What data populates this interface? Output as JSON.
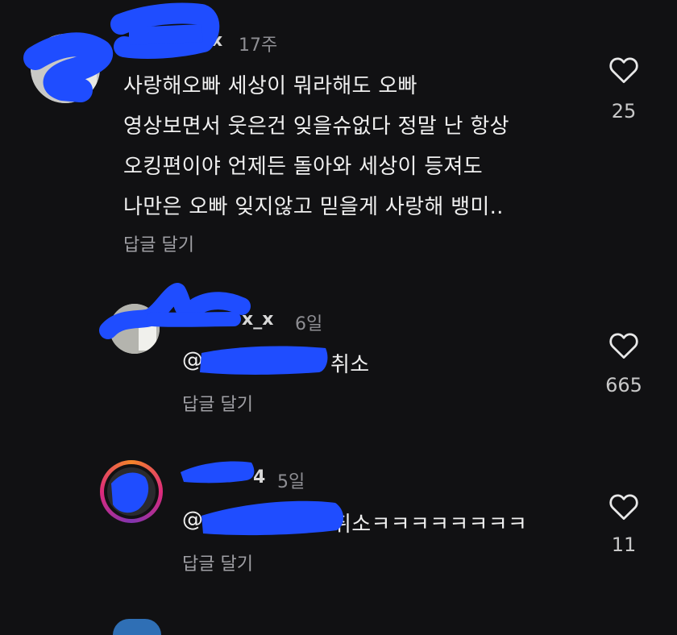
{
  "comments": [
    {
      "username_suffix": "x",
      "time": "17주",
      "lines": [
        "사랑해오빠 세상이 뭐라해도 오빠",
        "영상보면서 웃은건 잊을슈없다 정말 난 항상",
        "오킹편이야 언제든 돌아와 세상이 등져도",
        "나만은 오빠 잊지않고 믿을게 사랑해 뱅미.."
      ],
      "reply_label": "답글 달기",
      "likes": "25",
      "like_icon": "heart-outline-icon"
    },
    {
      "username_suffix": "x_x",
      "time": "6일",
      "mention_prefix": "@",
      "mention_text": "취소",
      "reply_label": "답글 달기",
      "likes": "665",
      "like_icon": "heart-outline-icon"
    },
    {
      "username_suffix": "4",
      "time": "5일",
      "mention_prefix": "@",
      "mention_text": "취소ㅋㅋㅋㅋㅋㅋㅋㅋ",
      "reply_label": "답글 달기",
      "likes": "11",
      "like_icon": "heart-outline-icon"
    }
  ],
  "colors": {
    "background": "#111113",
    "redaction_marker": "#1f4dff",
    "story_ring": "#dd2a7b"
  }
}
